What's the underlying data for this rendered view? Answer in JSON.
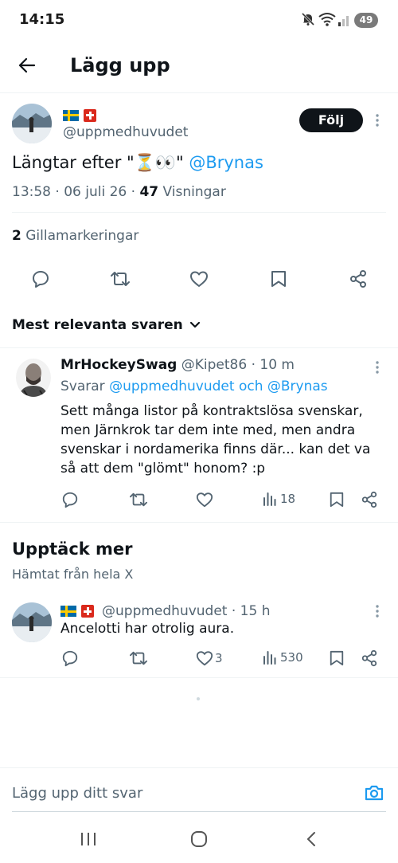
{
  "status_bar": {
    "time": "14:15",
    "battery": "49"
  },
  "header": {
    "title": "Lägg upp"
  },
  "main_post": {
    "handle": "@uppmedhuvudet",
    "follow_label": "Följ",
    "text_before": "Längtar efter \"",
    "emoji": "⏳👀",
    "text_after": "\" ",
    "mention": "@Brynas",
    "time": "13:58",
    "sep1": " · ",
    "date": "06 juli 26",
    "sep2": " · ",
    "views_count": "47",
    "views_label": " Visningar",
    "likes_count": "2",
    "likes_label": " Gillamarkeringar"
  },
  "replies_filter": {
    "label": "Mest relevanta svaren"
  },
  "reply": {
    "name": "MrHockeySwag",
    "handle": "@Kipet86",
    "time": " · 10 m",
    "replying_prefix": "Svarar ",
    "replying_to": "@uppmedhuvudet och @Brynas",
    "text": "Sett många listor på kontraktslösa svenskar, men Järnkrok tar dem inte med, men andra svenskar i nordamerika finns där... kan det va så att dem \"glömt\" honom? :p",
    "views": "18"
  },
  "discover": {
    "title": "Upptäck mer",
    "subtitle": "Hämtat från hela X"
  },
  "discover_post": {
    "handle": "@uppmedhuvudet",
    "time": " · 15 h",
    "text": "Ancelotti har otrolig aura.",
    "likes": "3",
    "views": "530"
  },
  "reply_bar": {
    "placeholder": "Lägg upp ditt svar"
  },
  "colors": {
    "accent": "#1d9bf0",
    "text": "#0f1419",
    "muted": "#536471"
  }
}
